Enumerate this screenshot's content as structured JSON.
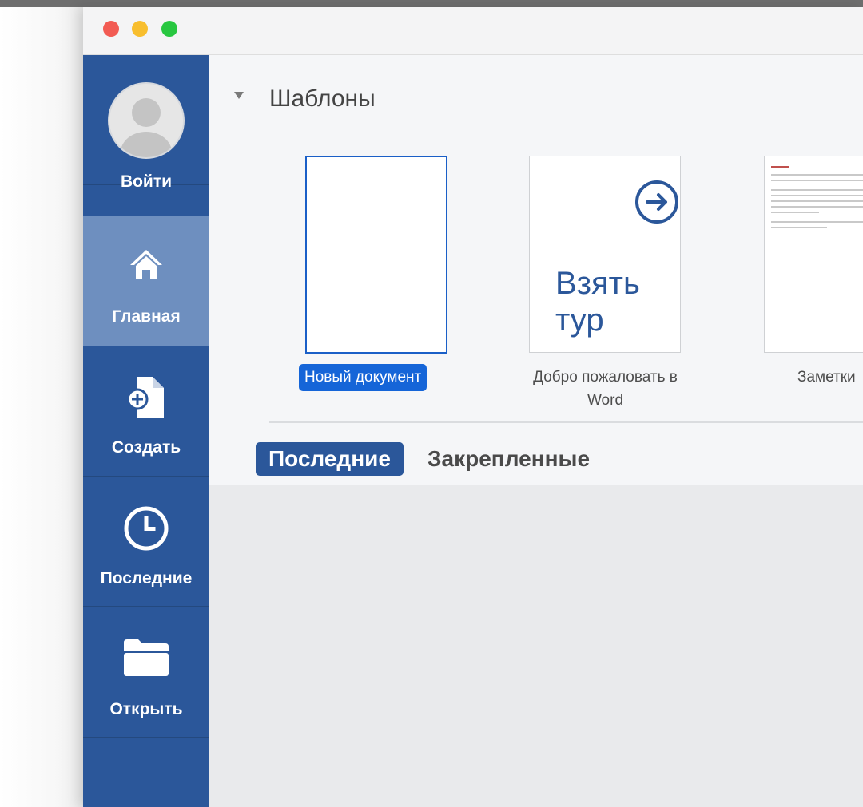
{
  "window": {
    "traffic_lights": [
      "#f25b53",
      "#f8be2e",
      "#28c740"
    ]
  },
  "sidebar": {
    "accent": "#2b579a",
    "items": [
      {
        "label": "Войти",
        "icon": "user-avatar-icon"
      },
      {
        "label": "Главная",
        "icon": "home-icon",
        "active": true
      },
      {
        "label": "Создать",
        "icon": "new-document-icon"
      },
      {
        "label": "Последние",
        "icon": "clock-icon"
      },
      {
        "label": "Открыть",
        "icon": "folder-icon"
      }
    ]
  },
  "templates": {
    "title": "Шаблоны",
    "items": [
      {
        "caption": "Новый документ",
        "selected": true
      },
      {
        "caption_line1": "Добро пожаловать в",
        "caption_line2": "Word",
        "tile_text_line1": "Взять",
        "tile_text_line2": "тур",
        "icon": "arrow-right-circle-icon"
      },
      {
        "caption": "Заметки"
      }
    ]
  },
  "tabs": {
    "recent": "Последние",
    "pinned": "Закрепленные"
  },
  "colors": {
    "selection": "#1565d8",
    "active_nav": "#6e8fbf"
  }
}
